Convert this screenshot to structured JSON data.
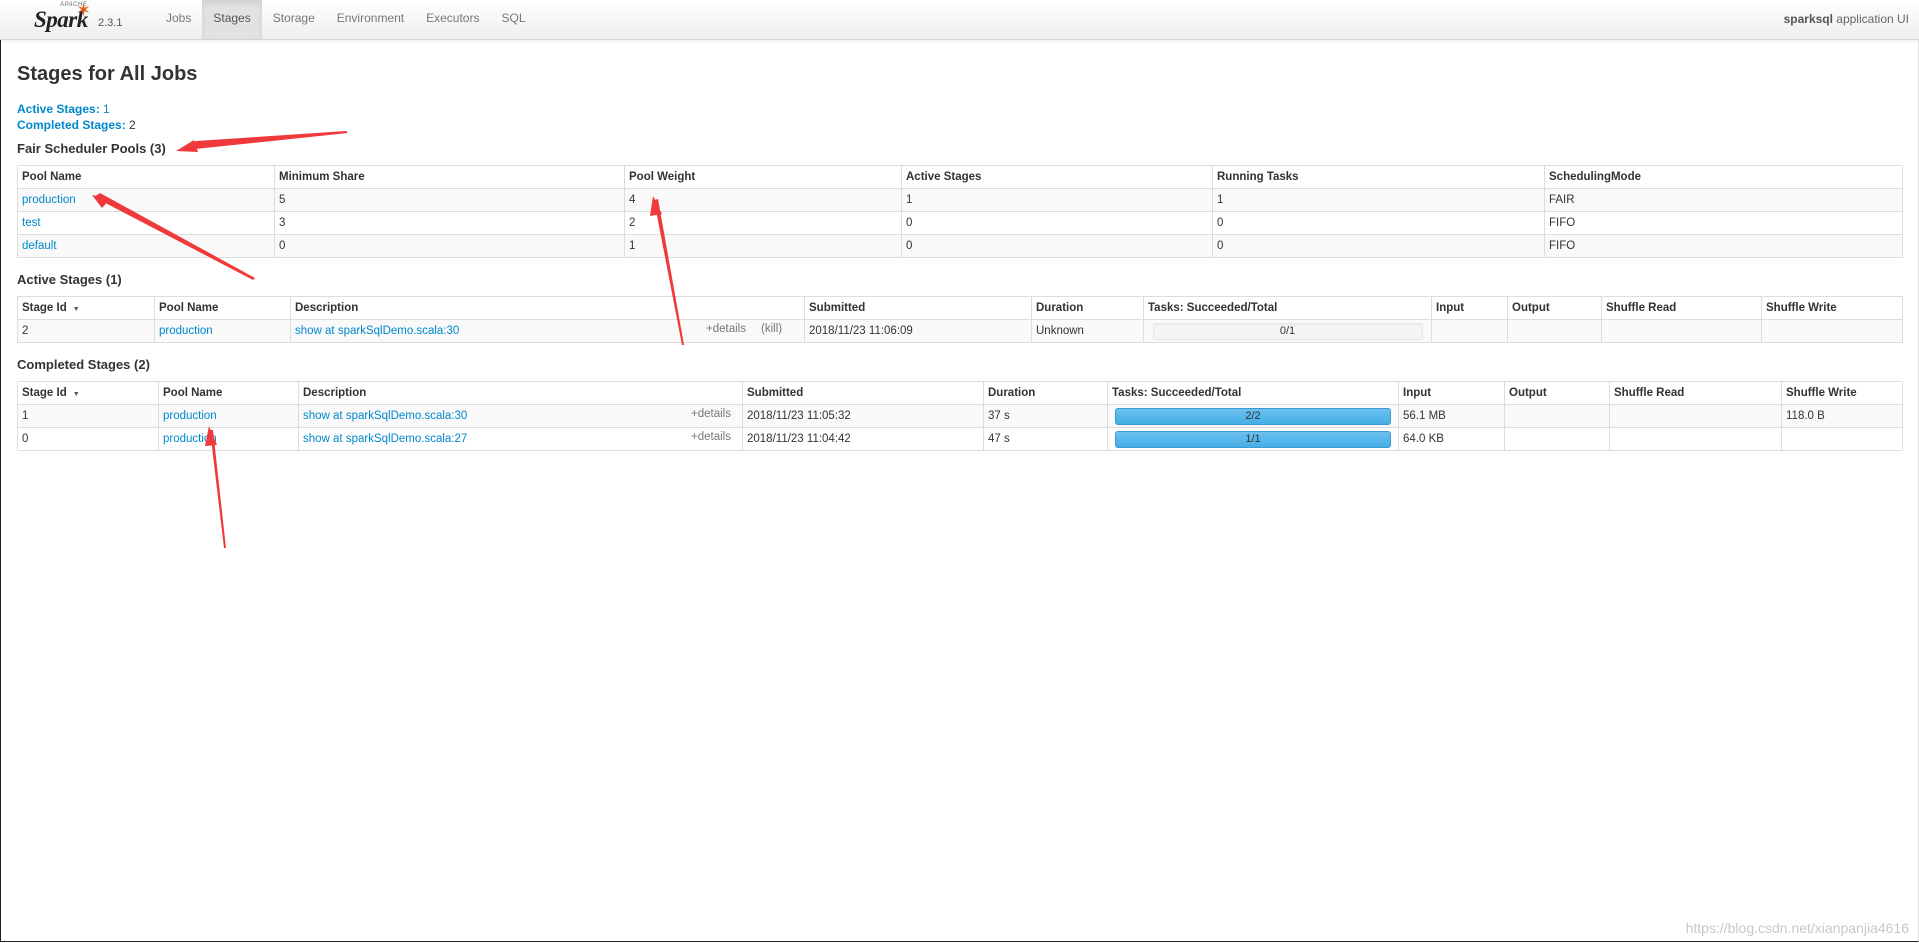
{
  "brand": {
    "apache": "APACHE",
    "name": "Spark",
    "version": "2.3.1"
  },
  "nav": {
    "items": [
      {
        "label": "Jobs",
        "active": false
      },
      {
        "label": "Stages",
        "active": true
      },
      {
        "label": "Storage",
        "active": false
      },
      {
        "label": "Environment",
        "active": false
      },
      {
        "label": "Executors",
        "active": false
      },
      {
        "label": "SQL",
        "active": false
      }
    ],
    "app_name": "sparksql",
    "app_suffix": " application UI"
  },
  "page_title": "Stages for All Jobs",
  "summary": {
    "active_label": "Active Stages:",
    "active_value": "1",
    "completed_label": "Completed Stages:",
    "completed_value": "2"
  },
  "pools": {
    "heading": "Fair Scheduler Pools (3)",
    "columns": [
      "Pool Name",
      "Minimum Share",
      "Pool Weight",
      "Active Stages",
      "Running Tasks",
      "SchedulingMode"
    ],
    "rows": [
      [
        "production",
        "5",
        "4",
        "1",
        "1",
        "FAIR"
      ],
      [
        "test",
        "3",
        "2",
        "0",
        "0",
        "FIFO"
      ],
      [
        "default",
        "0",
        "1",
        "0",
        "0",
        "FIFO"
      ]
    ]
  },
  "active_stages": {
    "heading": "Active Stages (1)",
    "columns": [
      "Stage Id",
      "Pool Name",
      "Description",
      "Submitted",
      "Duration",
      "Tasks: Succeeded/Total",
      "Input",
      "Output",
      "Shuffle Read",
      "Shuffle Write"
    ],
    "sort_icon": "▼",
    "details_label": "+details",
    "kill_label": "(kill)",
    "rows": [
      {
        "id": "2",
        "pool": "production",
        "desc": "show at sparkSqlDemo.scala:30",
        "submitted": "2018/11/23 11:06:09",
        "duration": "Unknown",
        "tasks": "0/1",
        "progress": 0,
        "input": "",
        "output": "",
        "shuffle_read": "",
        "shuffle_write": ""
      }
    ]
  },
  "completed_stages": {
    "heading": "Completed Stages (2)",
    "columns": [
      "Stage Id",
      "Pool Name",
      "Description",
      "Submitted",
      "Duration",
      "Tasks: Succeeded/Total",
      "Input",
      "Output",
      "Shuffle Read",
      "Shuffle Write"
    ],
    "sort_icon": "▼",
    "details_label": "+details",
    "rows": [
      {
        "id": "1",
        "pool": "production",
        "desc": "show at sparkSqlDemo.scala:30",
        "submitted": "2018/11/23 11:05:32",
        "duration": "37 s",
        "tasks": "2/2",
        "progress": 1,
        "input": "56.1 MB",
        "output": "",
        "shuffle_read": "",
        "shuffle_write": "118.0 B"
      },
      {
        "id": "0",
        "pool": "production",
        "desc": "show at sparkSqlDemo.scala:27",
        "submitted": "2018/11/23 11:04:42",
        "duration": "47 s",
        "tasks": "1/1",
        "progress": 1,
        "input": "64.0 KB",
        "output": "",
        "shuffle_read": "",
        "shuffle_write": ""
      }
    ]
  },
  "watermark": "https://blog.csdn.net/xianpanjia4616",
  "colors": {
    "link": "#0088cc",
    "arrow": "#f0393a",
    "progress": "#44aee6"
  }
}
